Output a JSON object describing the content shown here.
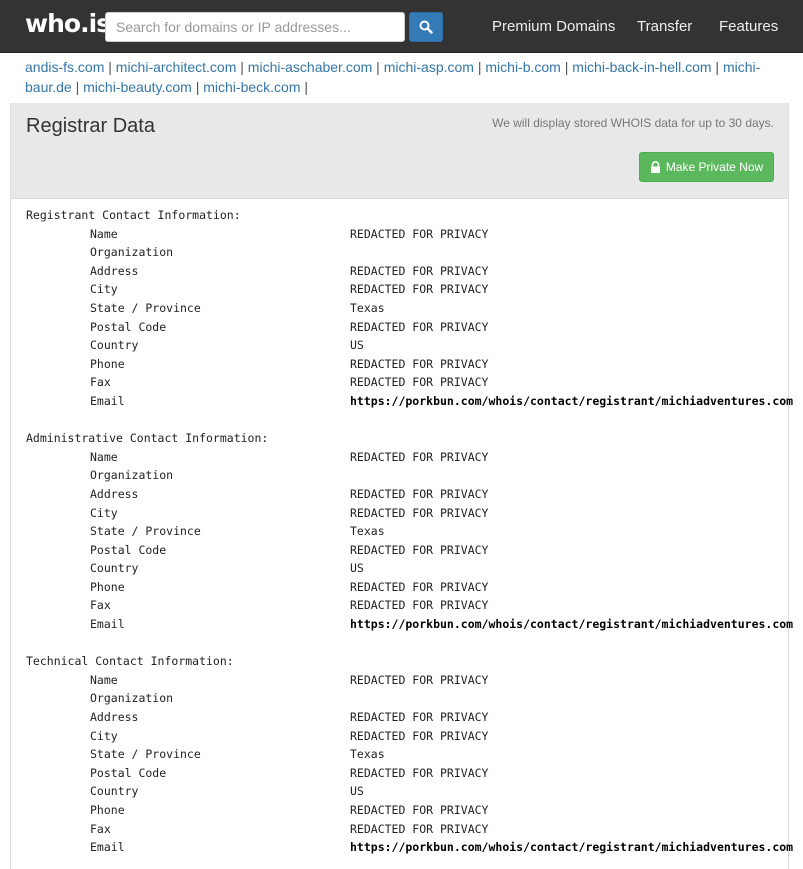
{
  "header": {
    "logo": "who.is",
    "search_placeholder": "Search for domains or IP addresses...",
    "nav": [
      "Premium Domains",
      "Transfer",
      "Features"
    ]
  },
  "related_domains": [
    "andis-fs.com",
    "michi-architect.com",
    "michi-aschaber.com",
    "michi-asp.com",
    "michi-b.com",
    "michi-back-in-hell.com",
    "michi-baur.de",
    "michi-beauty.com",
    "michi-beck.com"
  ],
  "registrar": {
    "title": "Registrar Data",
    "note": "We will display stored WHOIS data for up to 30 days.",
    "button": "Make Private Now"
  },
  "contacts": [
    {
      "heading": "Registrant Contact Information:",
      "fields": [
        {
          "k": "Name",
          "v": "REDACTED FOR PRIVACY"
        },
        {
          "k": "Organization",
          "v": ""
        },
        {
          "k": "Address",
          "v": "REDACTED FOR PRIVACY"
        },
        {
          "k": "City",
          "v": "REDACTED FOR PRIVACY"
        },
        {
          "k": "State / Province",
          "v": "Texas"
        },
        {
          "k": "Postal Code",
          "v": "REDACTED FOR PRIVACY"
        },
        {
          "k": "Country",
          "v": "US"
        },
        {
          "k": "Phone",
          "v": "REDACTED FOR PRIVACY"
        },
        {
          "k": "Fax",
          "v": "REDACTED FOR PRIVACY"
        },
        {
          "k": "Email",
          "v": "https://porkbun.com/whois/contact/registrant/michiadventures.com"
        }
      ]
    },
    {
      "heading": "Administrative Contact Information:",
      "fields": [
        {
          "k": "Name",
          "v": "REDACTED FOR PRIVACY"
        },
        {
          "k": "Organization",
          "v": ""
        },
        {
          "k": "Address",
          "v": "REDACTED FOR PRIVACY"
        },
        {
          "k": "City",
          "v": "REDACTED FOR PRIVACY"
        },
        {
          "k": "State / Province",
          "v": "Texas"
        },
        {
          "k": "Postal Code",
          "v": "REDACTED FOR PRIVACY"
        },
        {
          "k": "Country",
          "v": "US"
        },
        {
          "k": "Phone",
          "v": "REDACTED FOR PRIVACY"
        },
        {
          "k": "Fax",
          "v": "REDACTED FOR PRIVACY"
        },
        {
          "k": "Email",
          "v": "https://porkbun.com/whois/contact/registrant/michiadventures.com"
        }
      ]
    },
    {
      "heading": "Technical Contact Information:",
      "fields": [
        {
          "k": "Name",
          "v": "REDACTED FOR PRIVACY"
        },
        {
          "k": "Organization",
          "v": ""
        },
        {
          "k": "Address",
          "v": "REDACTED FOR PRIVACY"
        },
        {
          "k": "City",
          "v": "REDACTED FOR PRIVACY"
        },
        {
          "k": "State / Province",
          "v": "Texas"
        },
        {
          "k": "Postal Code",
          "v": "REDACTED FOR PRIVACY"
        },
        {
          "k": "Country",
          "v": "US"
        },
        {
          "k": "Phone",
          "v": "REDACTED FOR PRIVACY"
        },
        {
          "k": "Fax",
          "v": "REDACTED FOR PRIVACY"
        },
        {
          "k": "Email",
          "v": "https://porkbun.com/whois/contact/registrant/michiadventures.com"
        }
      ]
    }
  ]
}
